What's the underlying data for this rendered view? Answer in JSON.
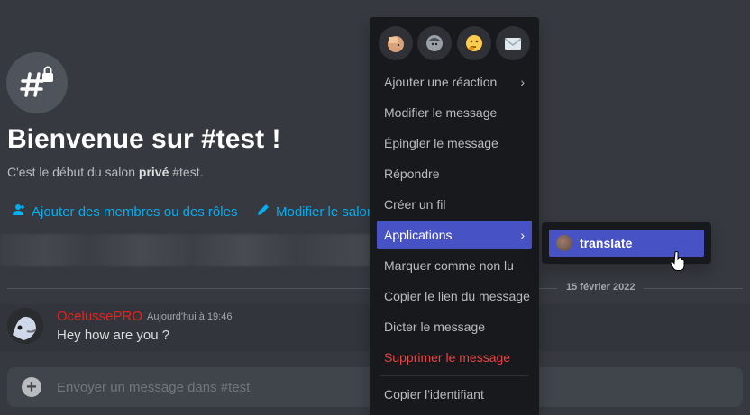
{
  "welcome": {
    "title": "Bienvenue sur #test !",
    "subtitle_prefix": "C'est le début du salon ",
    "subtitle_bold": "privé",
    "subtitle_suffix": " #test."
  },
  "actions": {
    "add_members": "Ajouter des membres ou des rôles",
    "edit_channel": "Modifier le salon"
  },
  "date_divider": "15 février 2022",
  "message": {
    "author": "OcelussePRO",
    "timestamp": "Aujourd'hui à 19:46",
    "content": "Hey how are you ?"
  },
  "composer": {
    "placeholder": "Envoyer un message dans #test"
  },
  "quick_reactions": [
    "face-palm-emoji",
    "face-emoji",
    "thinking-emoji",
    "envelope-emoji"
  ],
  "context_menu": {
    "add_reaction": "Ajouter une réaction",
    "edit_message": "Modifier le message",
    "pin_message": "Épingler le message",
    "reply": "Répondre",
    "create_thread": "Créer un fil",
    "applications": "Applications",
    "mark_unread": "Marquer comme non lu",
    "copy_link": "Copier le lien du message",
    "dictate": "Dicter le message",
    "delete": "Supprimer le message",
    "copy_id": "Copier l'identifiant"
  },
  "submenu": {
    "translate": "translate"
  },
  "colors": {
    "background": "#36393f",
    "link": "#00aff4",
    "author": "#e6221c",
    "menu_active": "#4752c4",
    "danger": "#ed4245"
  }
}
